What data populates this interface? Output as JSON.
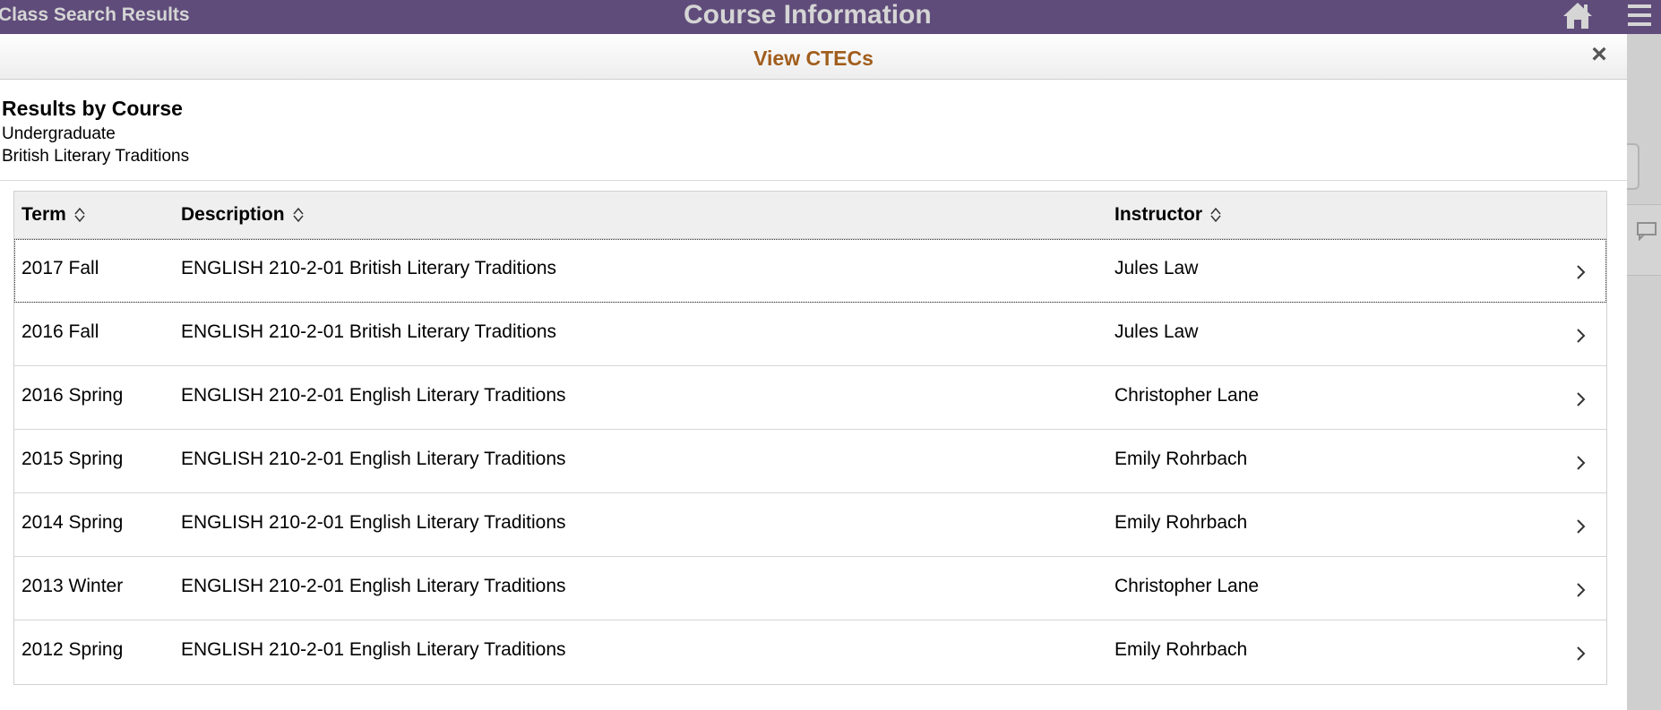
{
  "banner": {
    "back_label": "Class Search Results",
    "title": "Course Information",
    "home_icon": "home-icon",
    "menu_icon": "hamburger-menu-icon"
  },
  "modal": {
    "title": "View CTECs",
    "close_label": "×"
  },
  "info": {
    "heading": "Results by Course",
    "career": "Undergraduate",
    "course": "British Literary Traditions"
  },
  "grid": {
    "columns": [
      "Term",
      "Description",
      "Instructor"
    ],
    "rows": [
      {
        "term": "2017 Fall",
        "description": "ENGLISH 210-2-01 British Literary Traditions",
        "instructor": "Jules Law"
      },
      {
        "term": "2016 Fall",
        "description": "ENGLISH 210-2-01 British Literary Traditions",
        "instructor": "Jules Law"
      },
      {
        "term": "2016 Spring",
        "description": "ENGLISH 210-2-01 English Literary Traditions",
        "instructor": "Christopher Lane"
      },
      {
        "term": "2015 Spring",
        "description": "ENGLISH 210-2-01 English Literary Traditions",
        "instructor": "Emily Rohrbach"
      },
      {
        "term": "2014 Spring",
        "description": "ENGLISH 210-2-01 English Literary Traditions",
        "instructor": "Emily Rohrbach"
      },
      {
        "term": "2013 Winter",
        "description": "ENGLISH 210-2-01 English Literary Traditions",
        "instructor": "Christopher Lane"
      },
      {
        "term": "2012 Spring",
        "description": "ENGLISH 210-2-01 English Literary Traditions",
        "instructor": "Emily Rohrbach"
      }
    ]
  },
  "colors": {
    "banner": "#5f4c7a",
    "modal_title": "#a15d1b"
  }
}
